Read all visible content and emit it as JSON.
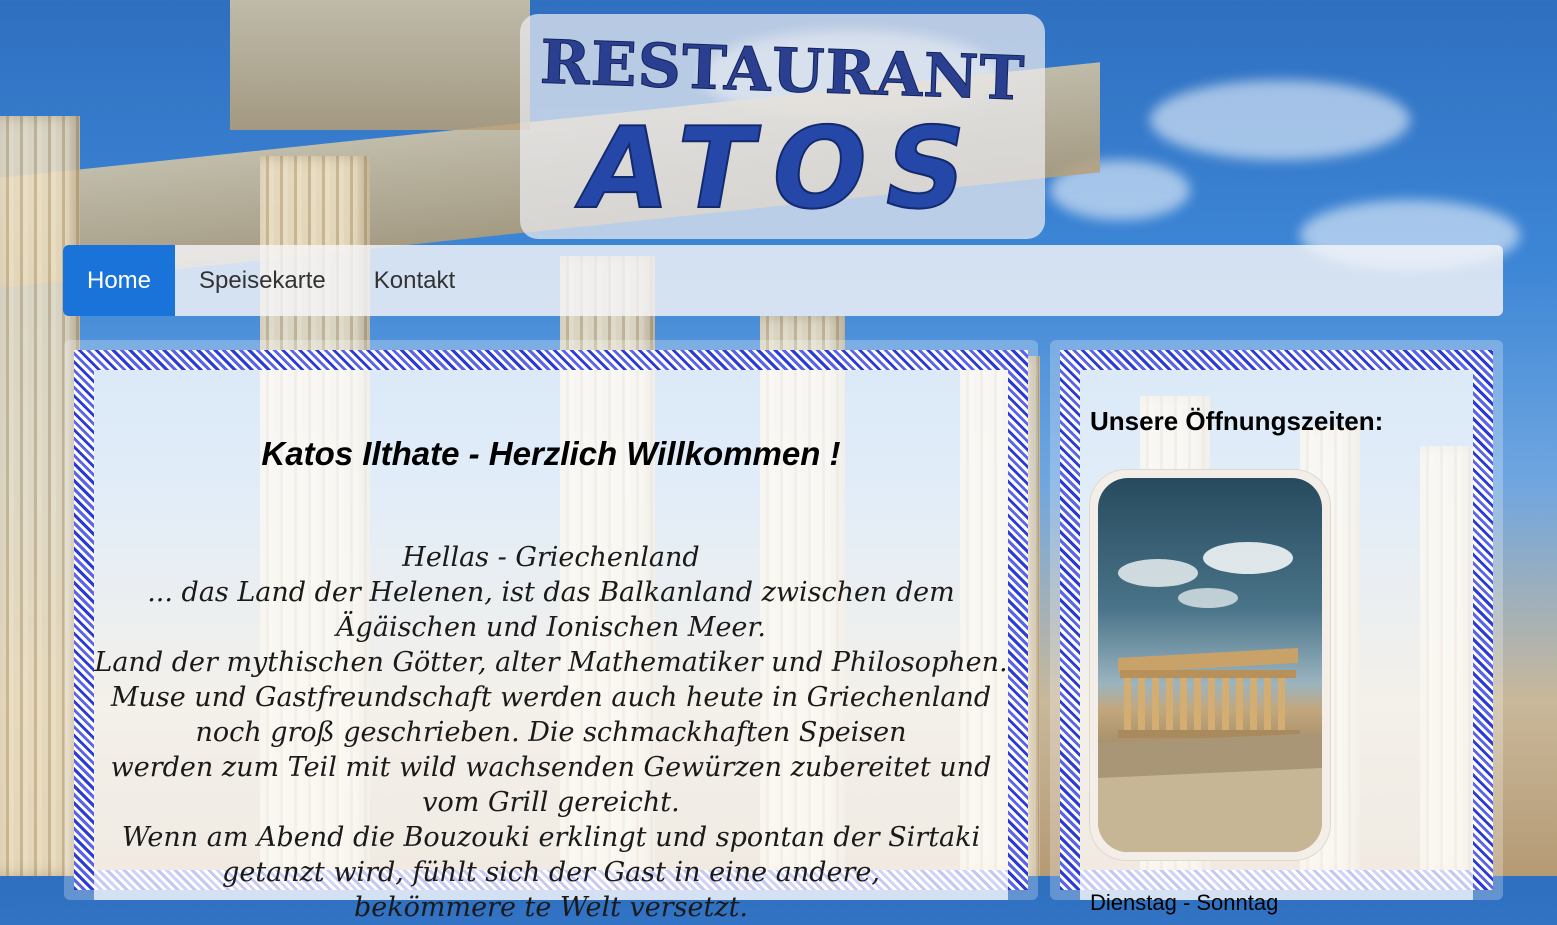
{
  "logo": {
    "line1": "RESTAURANT",
    "line2": "ATOS"
  },
  "nav": {
    "items": [
      {
        "label": "Home",
        "active": true
      },
      {
        "label": "Speisekarte",
        "active": false
      },
      {
        "label": "Kontakt",
        "active": false
      }
    ]
  },
  "main": {
    "title": "Katos Ilthate - Herzlich Willkommen !",
    "lines": [
      "Hellas - Griechenland",
      "... das Land der Helenen, ist das Balkanland zwischen dem",
      "Ägäischen und Ionischen Meer.",
      "Land der mythischen Götter, alter Mathematiker und Philosophen.",
      "Muse und Gastfreundschaft werden auch heute in Griechenland",
      "noch groß geschrieben. Die schmackhaften Speisen",
      "werden zum Teil mit wild wachsenden Gewürzen zubereitet und",
      "vom Grill gereicht.",
      "Wenn am Abend die Bouzouki erklingt und spontan der Sirtaki",
      "getanzt wird, fühlt sich der Gast in eine andere,",
      "bekömmere te Welt versetzt."
    ]
  },
  "sidebar": {
    "title": "Unsere Öffnungszeiten:",
    "days": "Dienstag - Sonntag"
  },
  "colors": {
    "nav_active": "#1a73d9",
    "logo_blue": "#2447a8",
    "meander_blue": "#2b3bd6"
  }
}
